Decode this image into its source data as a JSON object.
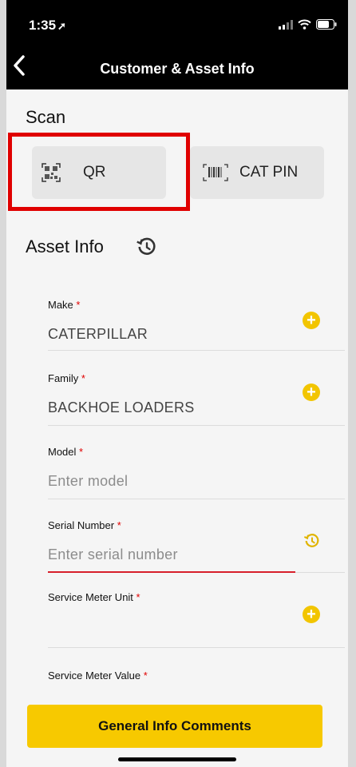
{
  "status_bar": {
    "time": "1:35",
    "location_glyph": "➚"
  },
  "nav": {
    "back_glyph": "‹",
    "title": "Customer & Asset Info"
  },
  "scan": {
    "title": "Scan",
    "qr_label": "QR",
    "cat_pin_label": "CAT PIN"
  },
  "asset_info": {
    "title": "Asset Info",
    "fields": [
      {
        "label": "Make",
        "required_mark": "*",
        "value": "CATERPILLAR"
      },
      {
        "label": "Family",
        "required_mark": "*",
        "value": "BACKHOE LOADERS"
      },
      {
        "label": "Model",
        "required_mark": "*",
        "placeholder": "Enter model"
      },
      {
        "label": "Serial Number",
        "required_mark": "*",
        "placeholder": "Enter serial number"
      },
      {
        "label": "Service Meter Unit",
        "required_mark": "*",
        "value": ""
      },
      {
        "label": "Service Meter Value",
        "required_mark": "*"
      }
    ],
    "add_glyph": "+"
  },
  "footer": {
    "button_label": "General Info Comments"
  },
  "colors": {
    "accent": "#f7c900",
    "required": "#e00000",
    "highlight": "#e00000",
    "nav_bg": "#000000"
  },
  "icons": [
    "location-arrow-icon",
    "signal-icon",
    "wifi-icon",
    "battery-icon",
    "back-chevron-icon",
    "qr-code-icon",
    "barcode-icon",
    "history-icon",
    "add-circle-icon"
  ]
}
